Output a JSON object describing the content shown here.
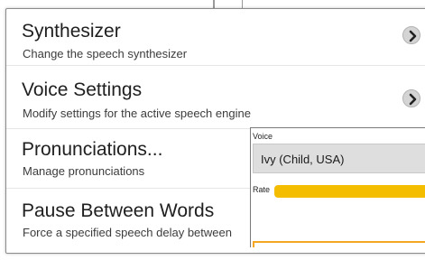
{
  "settings": [
    {
      "title": "Synthesizer",
      "subtitle": "Change the speech synthesizer",
      "chevron": "chevron-right-icon"
    },
    {
      "title": "Voice Settings",
      "subtitle": "Modify settings for the active speech engine",
      "chevron": "chevron-right-icon"
    },
    {
      "title": "Pronunciations...",
      "subtitle": "Manage pronunciations"
    },
    {
      "title": "Pause Between Words",
      "subtitle": "Force a specified speech delay between"
    }
  ],
  "voice_panel": {
    "voice_label": "Voice",
    "voice_value": "Ivy (Child, USA)",
    "rate_label": "Rate",
    "rate_fraction": 0.95
  },
  "colors": {
    "accent": "#f5bd00",
    "focus_border": "#f5a623"
  }
}
